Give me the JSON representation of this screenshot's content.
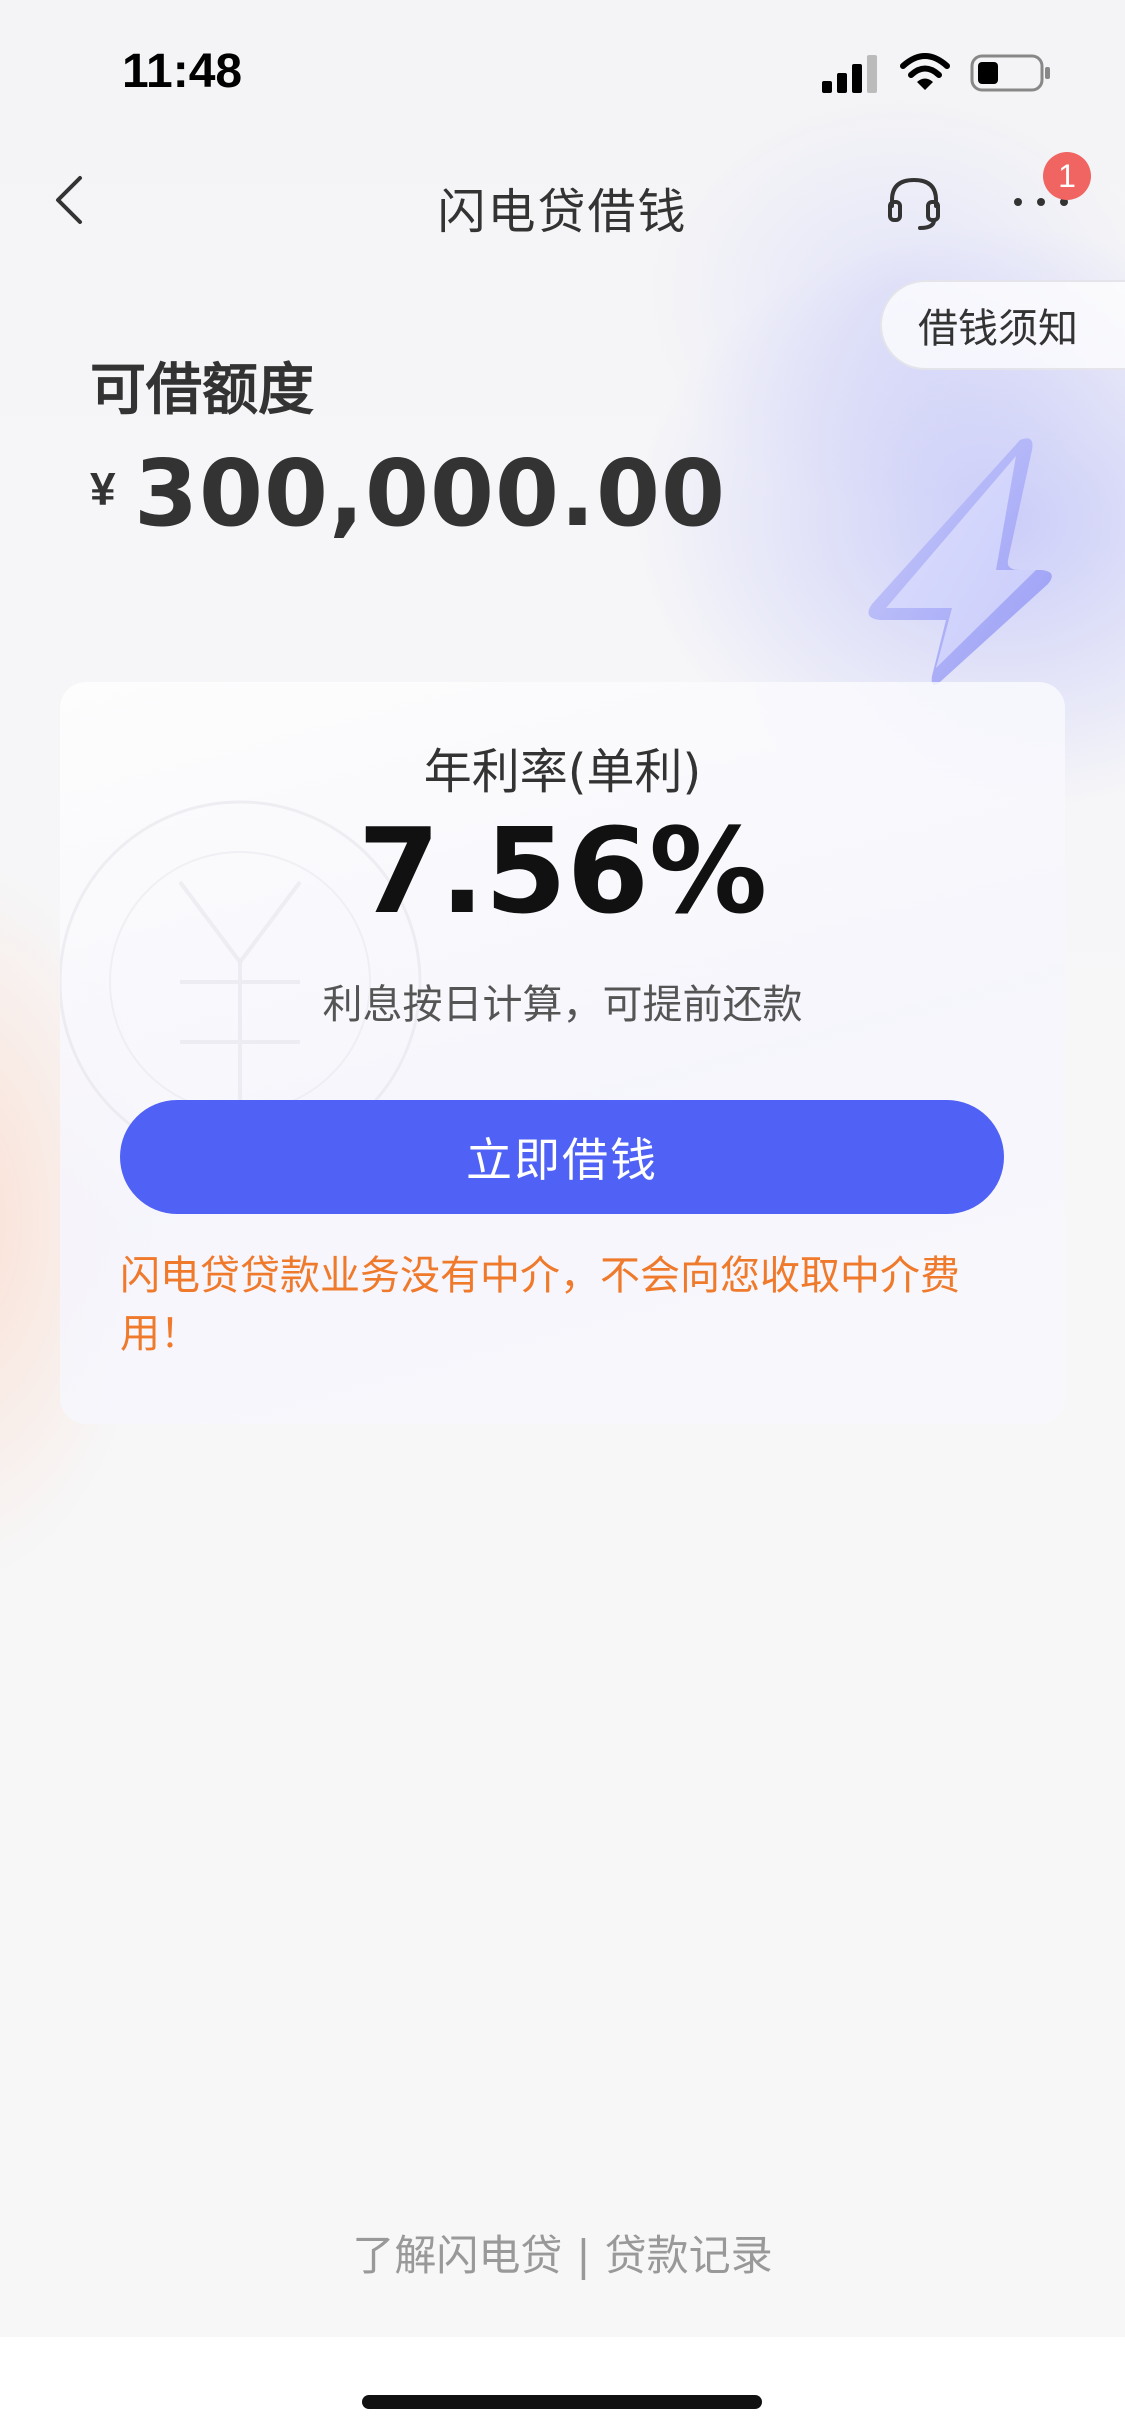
{
  "status_bar": {
    "time": "11:48",
    "icons": [
      "signal-icon",
      "wifi-icon",
      "battery-icon"
    ]
  },
  "nav": {
    "title": "闪电贷借钱",
    "back_icon": "chevron-left-icon",
    "service_icon": "headset-icon",
    "more_icon": "more-icon",
    "badge_count": "1"
  },
  "notice": {
    "label": "借钱须知"
  },
  "credit": {
    "label": "可借额度",
    "currency": "¥",
    "amount": "300,000.00"
  },
  "card": {
    "rate_label": "年利率(单利)",
    "rate_value": "7.56%",
    "rate_desc": "利息按日计算，可提前还款",
    "button_label": "立即借钱",
    "warning": "闪电贷贷款业务没有中介，不会向您收取中介费用！"
  },
  "footer": {
    "link_about": "了解闪电贷",
    "separator": "|",
    "link_records": "贷款记录"
  },
  "colors": {
    "accent": "#5062f5",
    "warning": "#f07a2c",
    "badge": "#f06462"
  }
}
